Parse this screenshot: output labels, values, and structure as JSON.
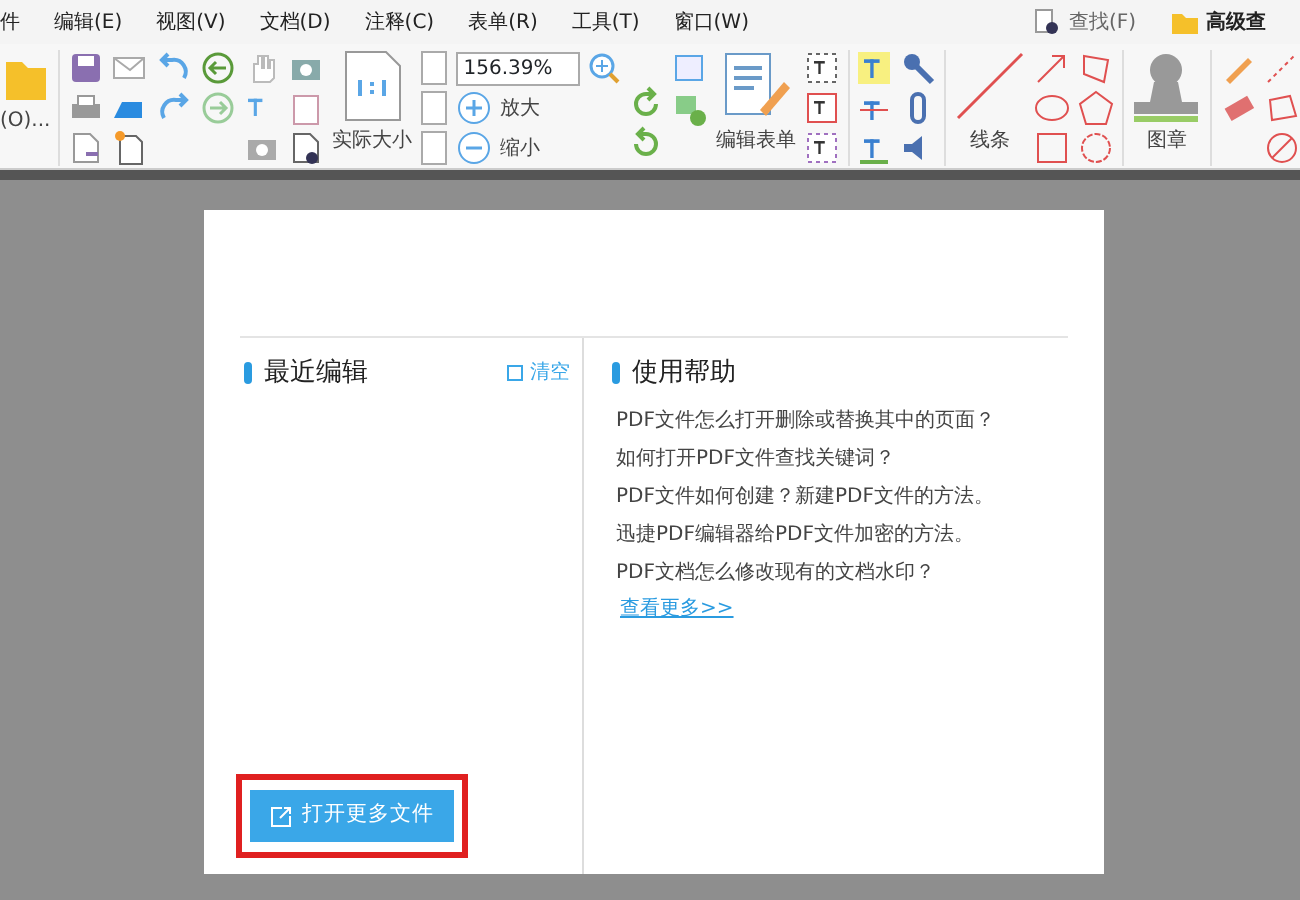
{
  "menu": [
    "件",
    "编辑(E)",
    "视图(V)",
    "文档(D)",
    "注释(C)",
    "表单(R)",
    "工具(T)",
    "窗口(W)"
  ],
  "top_right": [
    {
      "label": "查找(F)"
    },
    {
      "label": "高级查"
    }
  ],
  "toolbar": {
    "open_label": "(O)...",
    "actual_size": "实际大小",
    "zoom_value": "156.39%",
    "zoom_in": "放大",
    "zoom_out": "缩小",
    "edit_form": "编辑表单",
    "lines": "线条",
    "stamp": "图章"
  },
  "start_page": {
    "recent": {
      "title": "最近编辑",
      "clear": "清空"
    },
    "help": {
      "title": "使用帮助",
      "items": [
        "PDF文件怎么打开删除或替换其中的页面？",
        "如何打开PDF文件查找关键词？",
        "PDF文件如何创建？新建PDF文件的方法。",
        "迅捷PDF编辑器给PDF文件加密的方法。",
        "PDF文档怎么修改现有的文档水印？"
      ],
      "more": "查看更多>>"
    },
    "open_button": "打开更多文件",
    "open_button_highlighted": true
  }
}
